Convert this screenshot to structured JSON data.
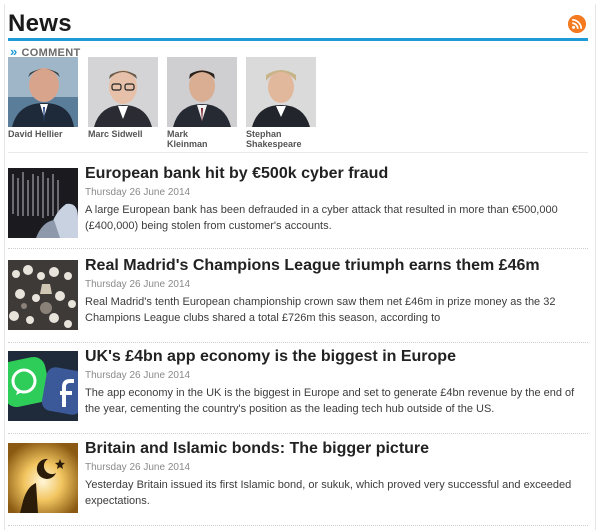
{
  "section": {
    "title": "News",
    "rss_icon": "rss-feed-icon",
    "accent_color": "#1e9bd7"
  },
  "comment": {
    "label": "COMMENT",
    "icon": "double-chevron-right-icon",
    "authors": [
      {
        "name": "David Hellier"
      },
      {
        "name": "Marc Sidwell"
      },
      {
        "name": "Mark Kleinman"
      },
      {
        "name": "Stephan Shakespeare"
      }
    ]
  },
  "articles": [
    {
      "headline": "European bank hit by €500k cyber fraud",
      "date": "Thursday 26 June 2014",
      "summary": "A large European bank has been defrauded in a cyber attack that resulted in more than €500,000 (£400,000) being stolen from customer's accounts."
    },
    {
      "headline": "Real Madrid's Champions League triumph earns them £46m",
      "date": "Thursday 26 June 2014",
      "summary": "Real Madrid's tenth European championship crown saw them net £46m in prize money as the 32 Champions League clubs shared a total £726m this season, according to"
    },
    {
      "headline": "UK's £4bn app economy is the biggest in Europe",
      "date": "Thursday 26 June 2014",
      "summary": "The app economy in the UK is the biggest in Europe and set to generate £4bn revenue by the end of the year, cementing the country's position as the leading tech hub outside of the US."
    },
    {
      "headline": "Britain and Islamic bonds: The bigger picture",
      "date": "Thursday 26 June 2014",
      "summary": "Yesterday Britain issued its first Islamic bond, or sukuk, which proved very successful and exceeded expectations."
    }
  ]
}
